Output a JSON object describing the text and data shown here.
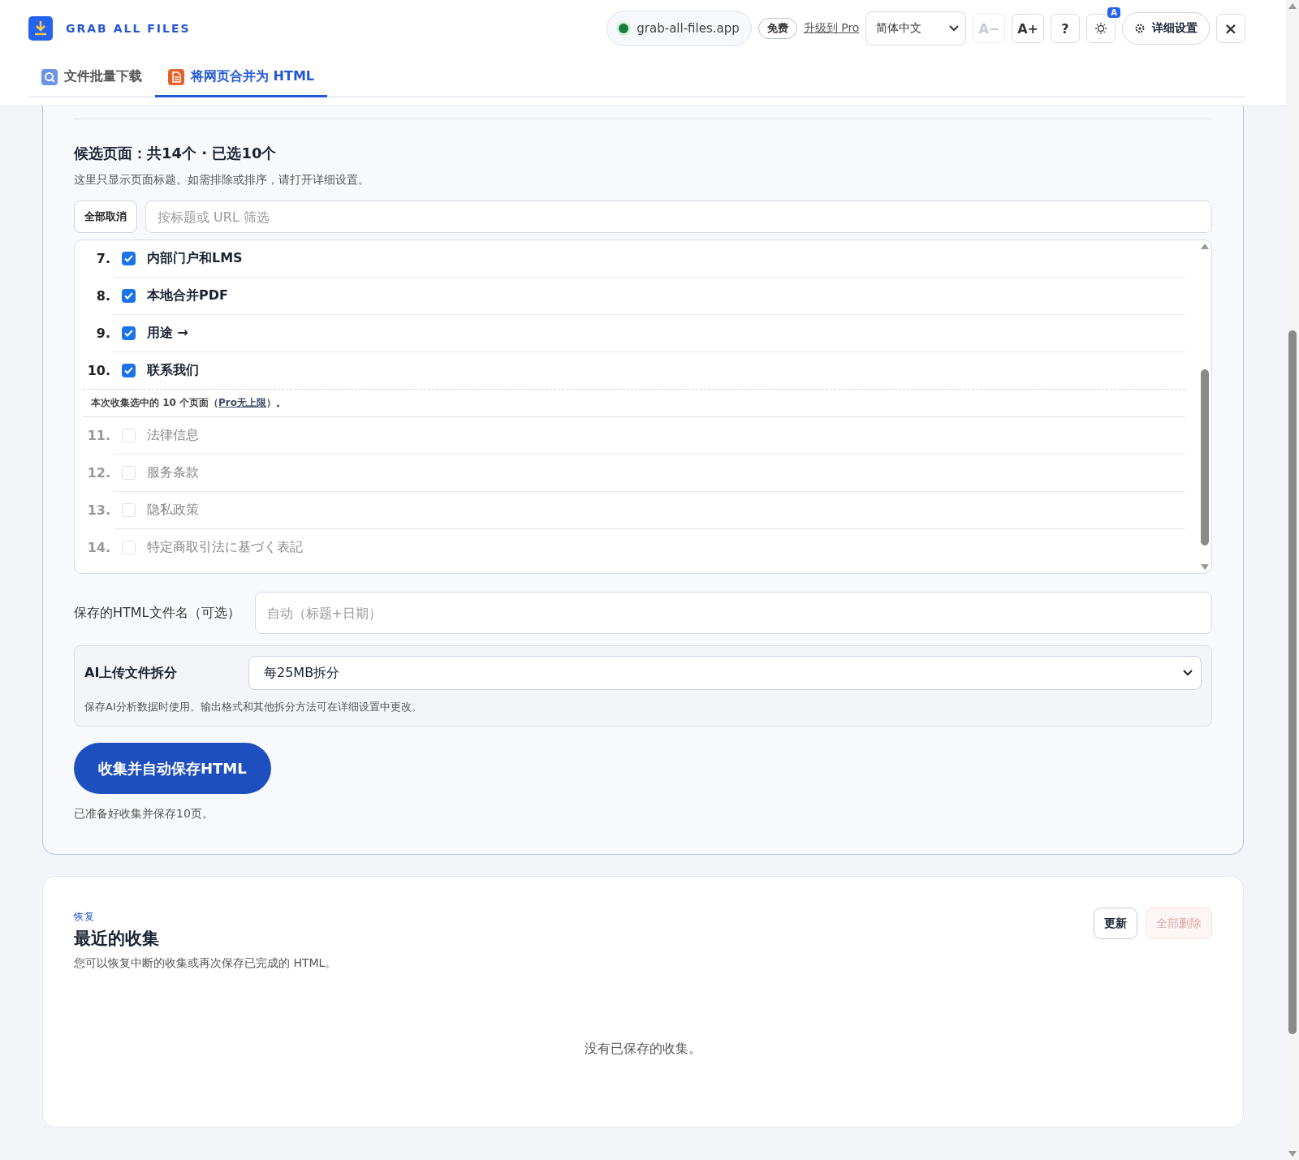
{
  "app": {
    "name": "GRAB ALL FILES"
  },
  "tabs": [
    {
      "label": "文件批量下载",
      "selected": false
    },
    {
      "label": "将网页合并为 HTML",
      "selected": true
    }
  ],
  "toolbar": {
    "domain": "grab-all-files.app",
    "plan_badge": "免费",
    "upgrade_link": "升级到 Pro",
    "language": "简体中文",
    "font_smaller": {
      "label": "A−",
      "disabled": true
    },
    "font_larger": {
      "label": "A+",
      "disabled": false
    },
    "help": "?",
    "theme_badge": "A",
    "settings": "详细设置",
    "close": "×"
  },
  "candidates": {
    "title": "候选页面：共14个 · 已选10个",
    "subtitle": "这里只显示页面标题。如需排除或排序，请打开详细设置。",
    "toggle_all": "全部取消",
    "filter": {
      "placeholder": "按标题或 URL 筛选"
    },
    "rows": [
      {
        "kind": "page",
        "number": "7.",
        "title": "内部门户和LMS",
        "checked": true,
        "disabled": false
      },
      {
        "kind": "page",
        "number": "8.",
        "title": "本地合并PDF",
        "checked": true,
        "disabled": false
      },
      {
        "kind": "page",
        "number": "9.",
        "title": "用途 →",
        "checked": true,
        "disabled": false
      },
      {
        "kind": "page",
        "number": "10.",
        "title": "联系我们",
        "checked": true,
        "disabled": false
      },
      {
        "kind": "note",
        "before": "本次收集选中的 10 个页面（",
        "link": "Pro无上限",
        "after": "）。"
      },
      {
        "kind": "page",
        "number": "11.",
        "title": "法律信息",
        "checked": false,
        "disabled": true
      },
      {
        "kind": "page",
        "number": "12.",
        "title": "服务条款",
        "checked": false,
        "disabled": true
      },
      {
        "kind": "page",
        "number": "13.",
        "title": "隐私政策",
        "checked": false,
        "disabled": true
      },
      {
        "kind": "page",
        "number": "14.",
        "title": "特定商取引法に基づく表記",
        "checked": false,
        "disabled": true
      }
    ]
  },
  "filename": {
    "label": "保存的HTML文件名（可选）",
    "placeholder": "自动（标题+日期）"
  },
  "split": {
    "label": "AI上传文件拆分",
    "value": "每25MB拆分",
    "hint": "保存AI分析数据时使用。输出格式和其他拆分方法可在详细设置中更改。"
  },
  "collect_button": "收集并自动保存HTML",
  "status": "已准备好收集并保存10页。",
  "recent": {
    "eyebrow": "恢复",
    "title": "最近的收集",
    "description": "您可以恢复中断的收集或再次保存已完成的 HTML。",
    "refresh": {
      "label": "更新",
      "disabled": false
    },
    "delete_all": {
      "label": "全部删除",
      "disabled": true
    },
    "empty": "没有已保存的收集。"
  }
}
